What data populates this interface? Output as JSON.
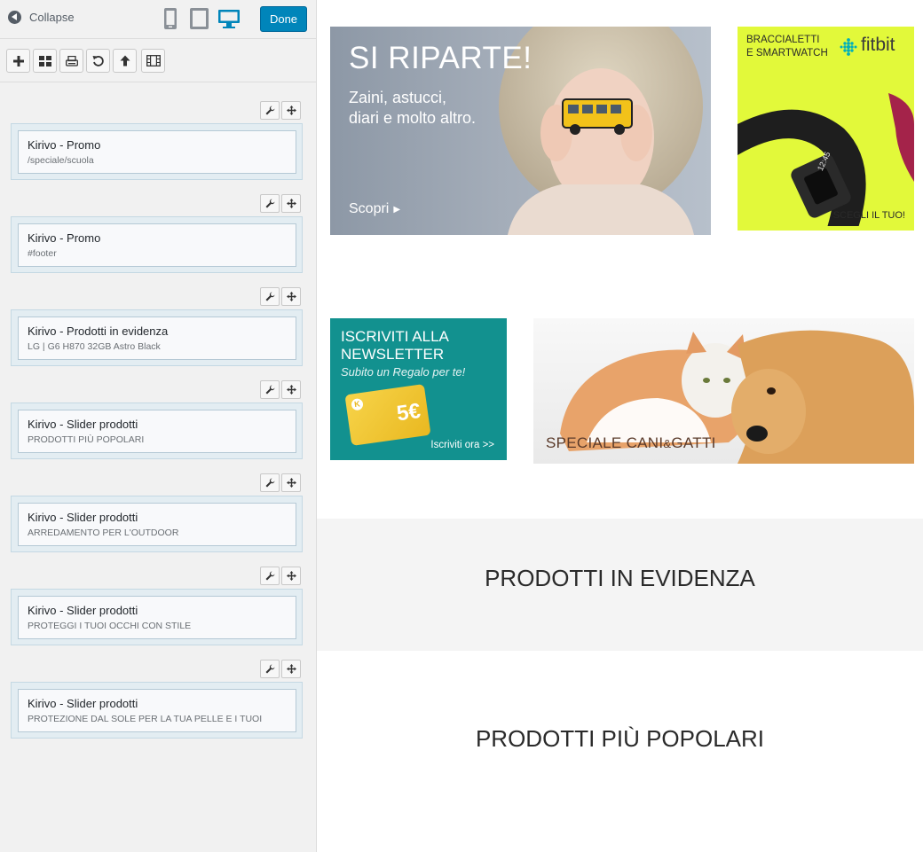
{
  "header": {
    "collapse_label": "Collapse",
    "done_label": "Done"
  },
  "devices": [
    "mobile",
    "tablet",
    "desktop"
  ],
  "toolbar_icons": [
    "add-icon",
    "grid-icon",
    "print-icon",
    "undo-icon",
    "arrow-up-icon",
    "film-icon"
  ],
  "widgets": [
    {
      "title": "Kirivo - Promo",
      "subtitle": "/speciale/scuola"
    },
    {
      "title": "Kirivo - Promo",
      "subtitle": "#footer"
    },
    {
      "title": "Kirivo - Prodotti in evidenza",
      "subtitle": "LG | G6 H870 32GB Astro Black"
    },
    {
      "title": "Kirivo - Slider prodotti",
      "subtitle": "PRODOTTI PIÙ POPOLARI"
    },
    {
      "title": "Kirivo - Slider prodotti",
      "subtitle": "ARREDAMENTO PER L'OUTDOOR"
    },
    {
      "title": "Kirivo - Slider prodotti",
      "subtitle": "PROTEGGI I TUOI OCCHI CON STILE"
    },
    {
      "title": "Kirivo - Slider prodotti",
      "subtitle": "PROTEZIONE DAL SOLE PER LA TUA PELLE E I TUOI"
    }
  ],
  "banners": {
    "school": {
      "headline": "SI RIPARTE!",
      "line1": "Zaini, astucci,",
      "line2": "diari e molto altro.",
      "cta": "Scopri"
    },
    "fitbit": {
      "line1": "BRACCIALETTI",
      "line2": "E SMARTWATCH",
      "brand": "fitbit",
      "cta": "SCEGLI IL TUO!",
      "display": "12:45"
    },
    "newsletter": {
      "line1": "ISCRIVITI ALLA",
      "line2": "NEWSLETTER",
      "sub": "Subito un Regalo per te!",
      "card_value": "5€",
      "card_logo": "K",
      "cta": "Iscriviti ora >>"
    },
    "pets": {
      "caption_a": "SPECIALE CANI",
      "caption_amp": "&",
      "caption_b": "GATTI"
    }
  },
  "sections": {
    "featured": "PRODOTTI IN EVIDENZA",
    "popular": "PRODOTTI PIÙ POPOLARI"
  },
  "colors": {
    "accent": "#0085ba",
    "fitbit_bg": "#e2f93a",
    "newsletter_bg": "#12918f"
  }
}
